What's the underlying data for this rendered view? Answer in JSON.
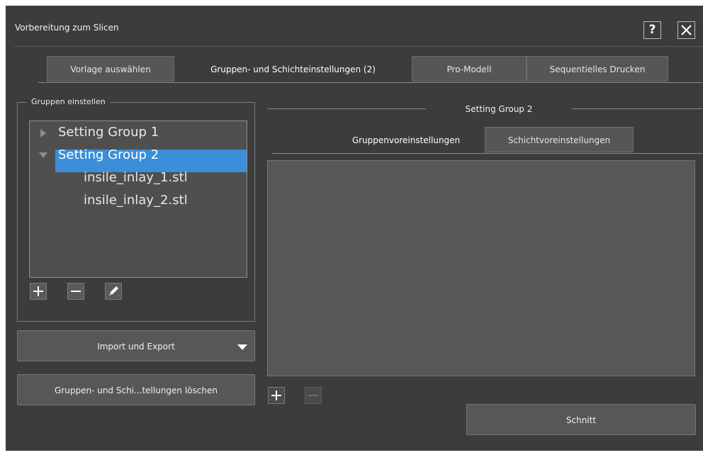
{
  "window": {
    "title": "Vorbereitung zum Slicen",
    "help_label": "?",
    "close_label": "✕"
  },
  "tabs": [
    {
      "label": "Vorlage auswählen",
      "active": false
    },
    {
      "label": "Gruppen- und Schichteinstellungen (2)",
      "active": true
    },
    {
      "label": "Pro-Modell",
      "active": false
    },
    {
      "label": "Sequentielles Drucken",
      "active": false
    }
  ],
  "groups_panel": {
    "legend": "Gruppen einstellen",
    "tree": [
      {
        "label": "Setting Group 1",
        "expanded": false,
        "selected": false,
        "children": []
      },
      {
        "label": "Setting Group 2",
        "expanded": true,
        "selected": true,
        "children": [
          "insile_inlay_1.stl",
          "insile_inlay_2.stl"
        ]
      }
    ],
    "buttons": {
      "add": "plus-icon",
      "remove": "minus-icon",
      "edit": "pencil-icon"
    }
  },
  "import_export_label": "Import und Export",
  "delete_label": "Gruppen- und Schi...tellungen löschen",
  "right_panel": {
    "legend": "Setting Group 2",
    "subtabs": [
      {
        "label": "Gruppenvoreinstellungen",
        "active": true
      },
      {
        "label": "Schichtvoreinstellungen",
        "active": false
      }
    ]
  },
  "slice_label": "Schnitt",
  "colors": {
    "dialog_bg": "#3c3c3c",
    "selection": "#3a8fd8",
    "button_bg": "#575757"
  }
}
